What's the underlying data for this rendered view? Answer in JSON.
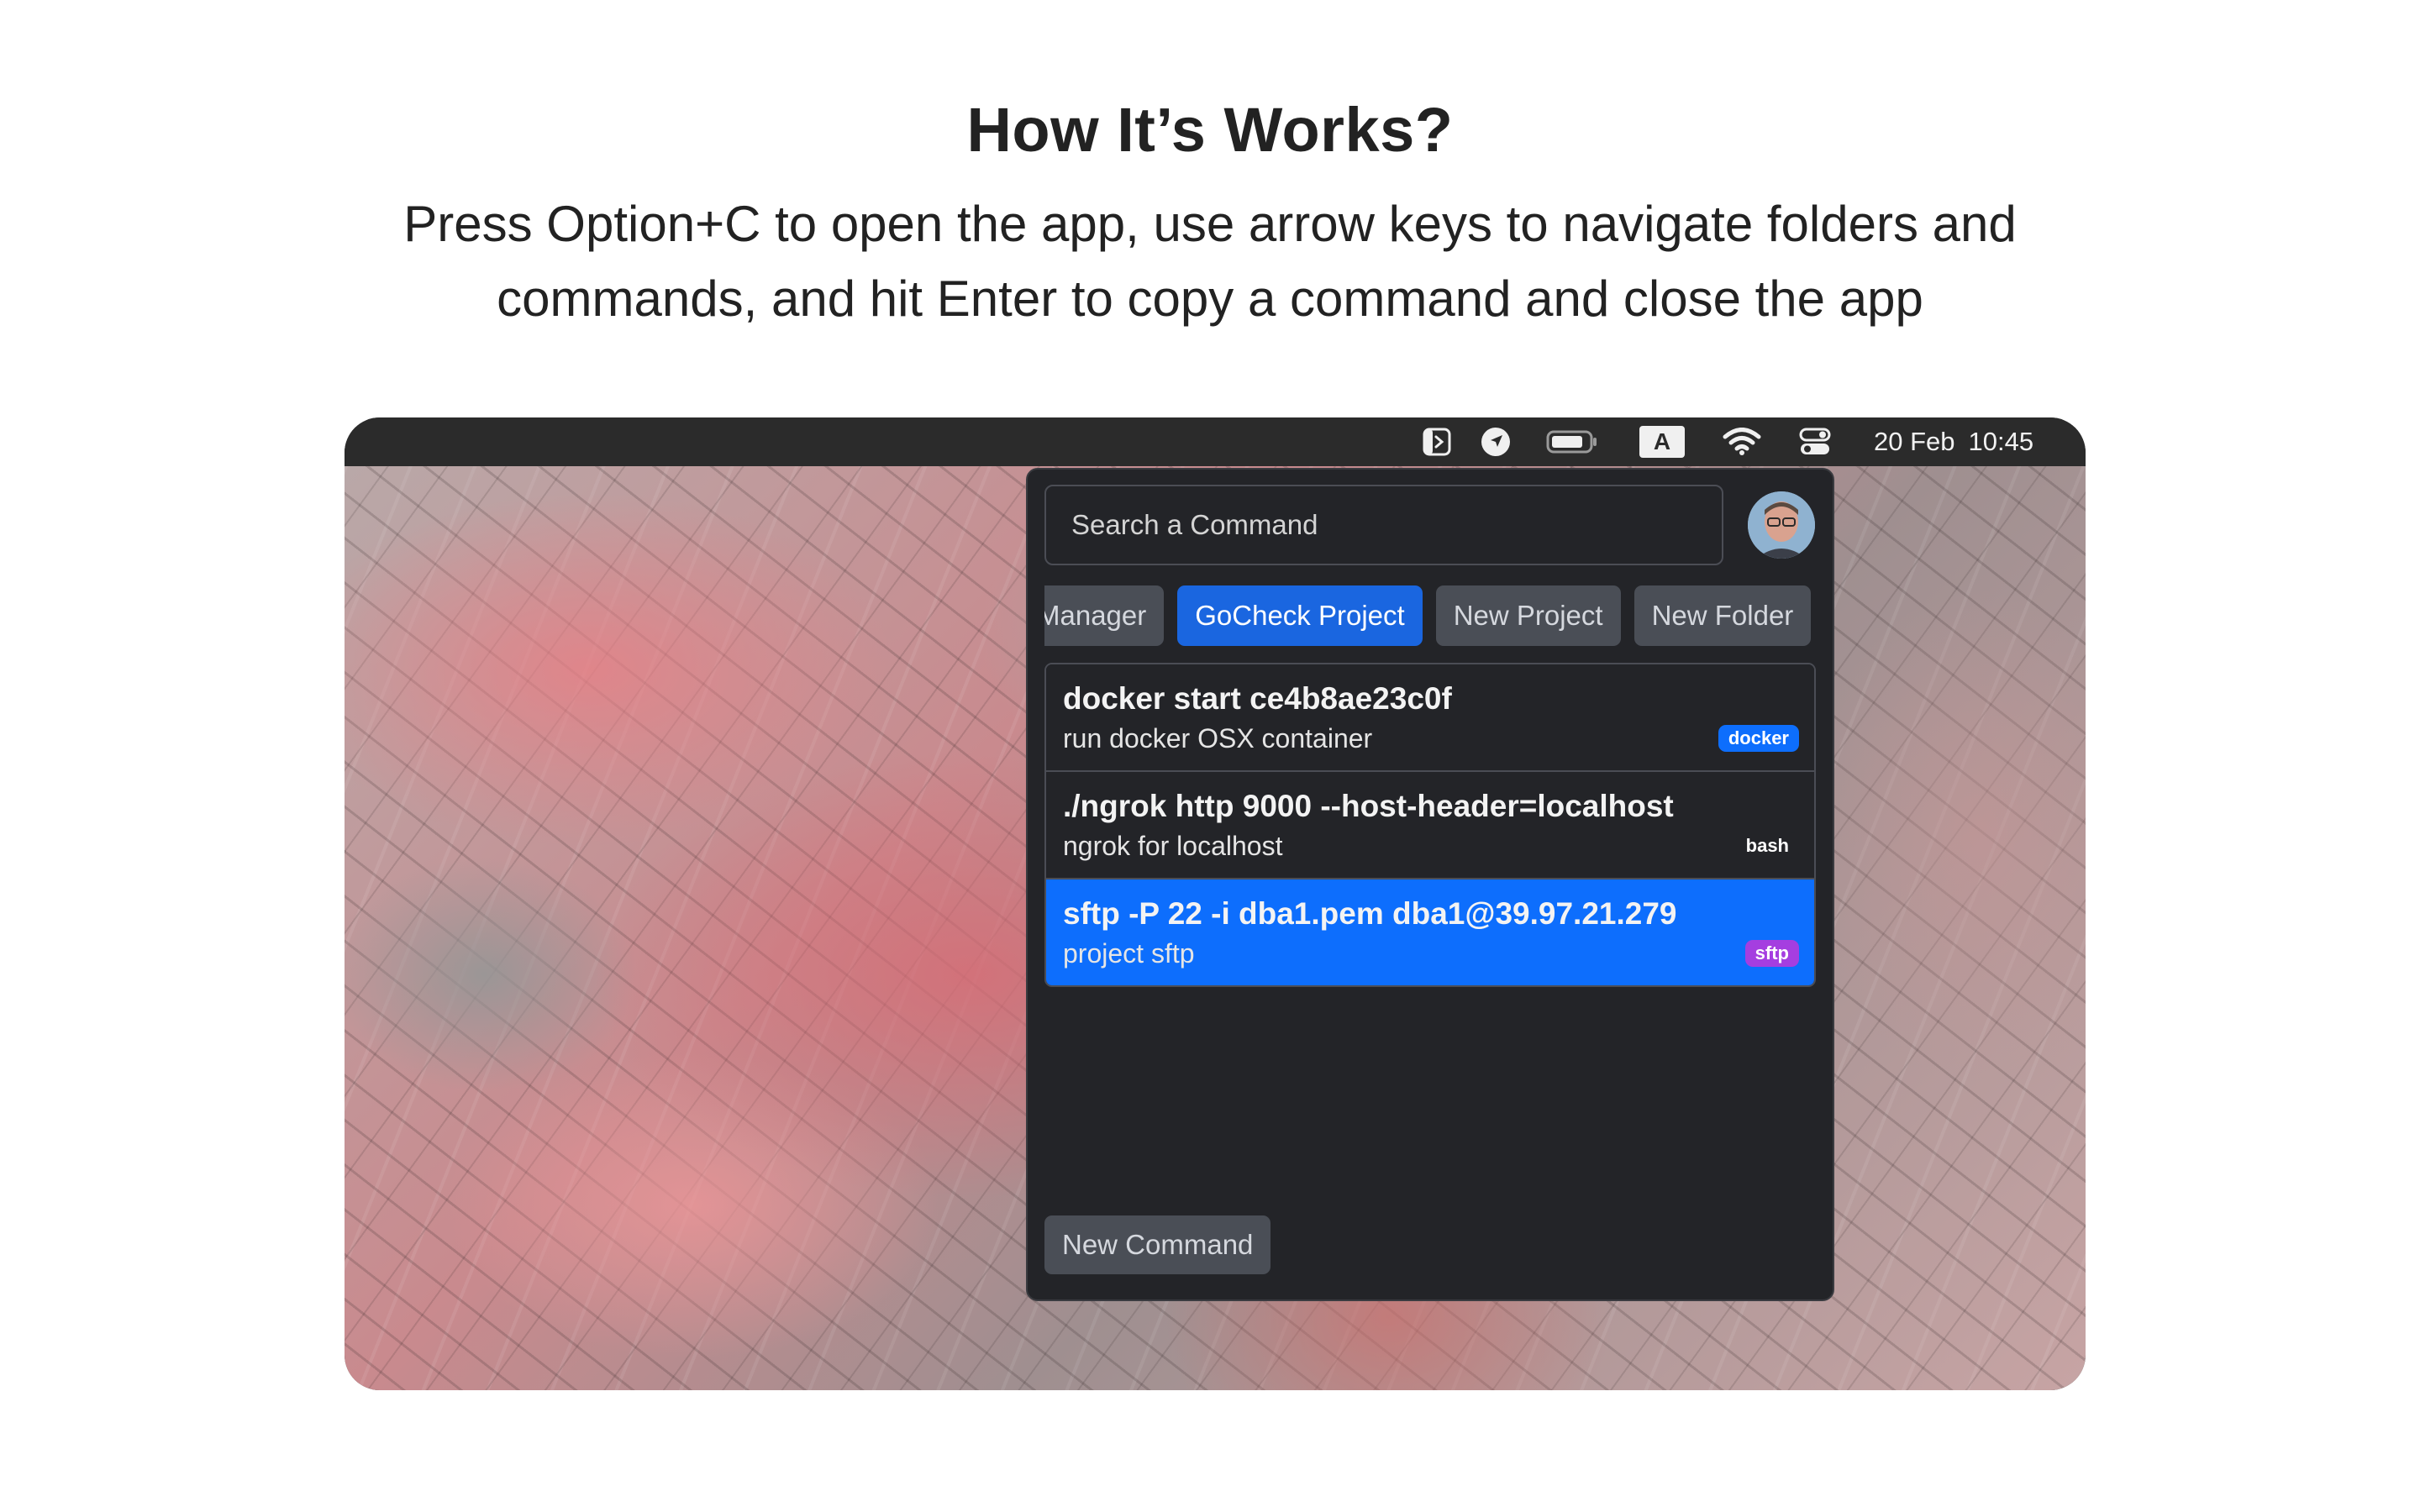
{
  "header": {
    "title": "How It’s Works?",
    "subtitle": "Press Option+C to open the app, use arrow keys to navigate folders and commands, and hit Enter to copy a command and close the app"
  },
  "menubar": {
    "icons": [
      "app-terminal-icon",
      "location-arrow-icon",
      "battery-icon",
      "input-source-icon",
      "wifi-icon",
      "control-center-icon"
    ],
    "input_source_label": "A",
    "date": "20 Feb",
    "time": "10:45"
  },
  "app": {
    "search_placeholder": "Search a Command",
    "tabs": [
      {
        "label": "Manager",
        "active": false
      },
      {
        "label": "GoCheck Project",
        "active": true
      },
      {
        "label": "New Project",
        "active": false
      },
      {
        "label": "New Folder",
        "active": false
      }
    ],
    "commands": [
      {
        "command": "docker start ce4b8ae23c0f",
        "description": "run docker OSX container",
        "tag": "docker",
        "tag_color": "#0d6efd",
        "selected": false
      },
      {
        "command": "./ngrok http 9000 --host-header=localhost",
        "description": "ngrok for localhost",
        "tag": "bash",
        "tag_color": "#232428",
        "selected": false
      },
      {
        "command": "sftp -P 22 -i dba1.pem dba1@39.97.21.279",
        "description": "project sftp",
        "tag": "sftp",
        "tag_color": "#a53ee0",
        "selected": true
      }
    ],
    "new_command_label": "New Command"
  },
  "colors": {
    "accent": "#0d6efd",
    "panel_bg": "#232428",
    "button_bg": "#4a4e56",
    "menubar_bg": "#2b2b2b"
  }
}
